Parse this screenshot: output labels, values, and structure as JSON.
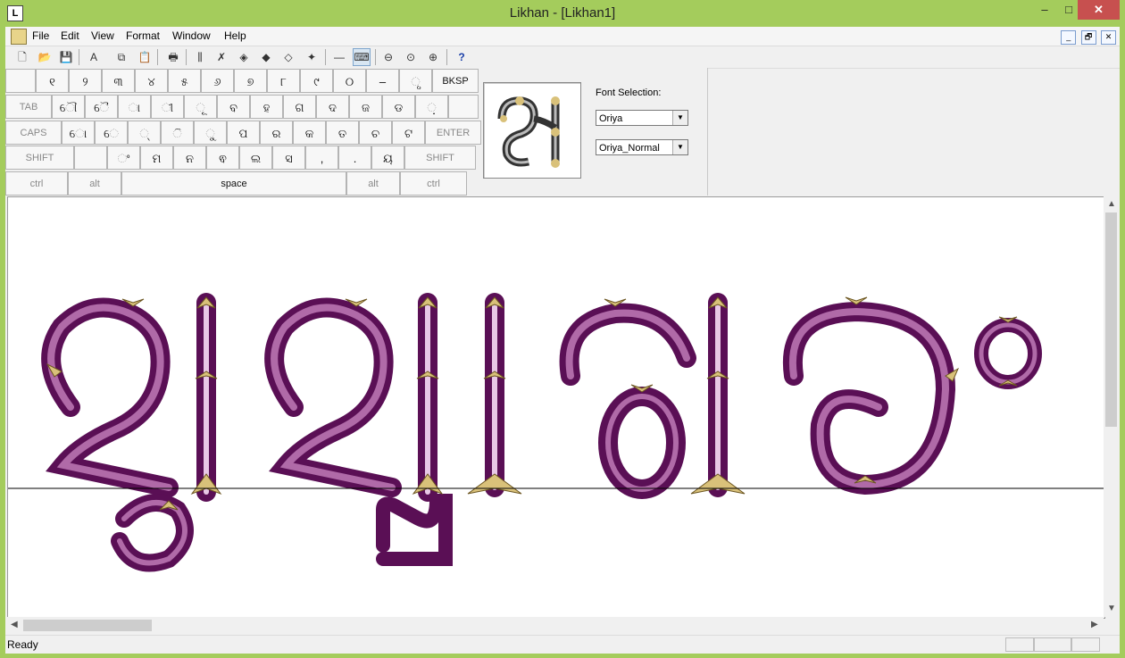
{
  "window": {
    "title": "Likhan - [Likhan1]",
    "app_icon": "L",
    "min": "–",
    "max": "□",
    "close": "✕"
  },
  "menu": {
    "items": [
      "File",
      "Edit",
      "View",
      "Format",
      "Window",
      "Help"
    ],
    "mdi": [
      "_",
      "🗗",
      "✕"
    ]
  },
  "toolbar": {
    "icons": [
      "new-file-icon",
      "open-icon",
      "save-icon",
      "font-icon",
      "copy-icon",
      "paste-icon",
      "print-icon",
      "columns-icon",
      "delete-style-icon",
      "fill-icon",
      "fill-color-icon",
      "fill-outline-icon",
      "fill-effect-icon",
      "line-icon",
      "keyboard-icon",
      "zoom-out-icon",
      "zoom-fit-icon",
      "zoom-in-icon",
      "help-icon"
    ],
    "help_label": "?"
  },
  "keyboard": {
    "row1": [
      "",
      "୧",
      "୨",
      "୩",
      "୪",
      "୫",
      "୬",
      "୭",
      "୮",
      "୯",
      "୦",
      "–",
      "ୃ",
      "BKSP"
    ],
    "row2": [
      "TAB",
      "ୌ",
      "ୈ",
      "ା",
      "ୀ",
      "ୂ",
      "ବ",
      "ହ",
      "ଗ",
      "ଦ",
      "ଜ",
      "ଡ",
      "଼",
      ""
    ],
    "row3": [
      "CAPS",
      "ୋ",
      "େ",
      "୍",
      "ି",
      "ୁ",
      "ପ",
      "ର",
      "କ",
      "ତ",
      "ଚ",
      "ଟ",
      "ENTER"
    ],
    "row4": [
      "SHIFT",
      "",
      "ଂ",
      "ମ",
      "ନ",
      "ଵ",
      "ଲ",
      "ସ",
      ",",
      ".",
      "ୟ",
      "SHIFT"
    ],
    "row5": [
      "ctrl",
      "alt",
      "space",
      "alt",
      "ctrl"
    ]
  },
  "font_panel": {
    "label": "Font Selection:",
    "font": "Oriya",
    "style": "Oriya_Normal"
  },
  "colors": {
    "titlebar": "#a4cc5c",
    "close": "#c7504f",
    "glyph_fill": "#7b1c73",
    "glyph_ornament": "#d9c17a"
  },
  "status": {
    "text": "Ready"
  }
}
